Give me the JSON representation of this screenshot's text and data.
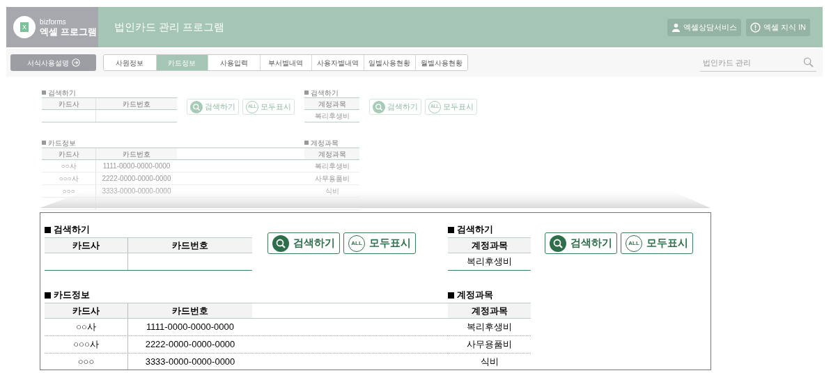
{
  "header": {
    "logo_icon_text": "X",
    "logo_top": "bizforms",
    "logo_main": "엑셀 프로그램",
    "title": "법인카드 관리 프로그램",
    "buttons": [
      {
        "kind": "consult",
        "label": "엑셀상담서비스"
      },
      {
        "kind": "info",
        "label": "엑셀 지식 IN"
      }
    ]
  },
  "nav": {
    "guide_button": "서식사용설명",
    "tabs": [
      {
        "label": "사원정보",
        "selected": false
      },
      {
        "label": "카드정보",
        "selected": true
      },
      {
        "label": "사용입력",
        "selected": false
      },
      {
        "label": "부서별내역",
        "selected": false
      },
      {
        "label": "사용자별내역",
        "selected": false
      },
      {
        "label": "일별사용현황",
        "selected": false
      },
      {
        "label": "월별사용현황",
        "selected": false
      }
    ],
    "search": {
      "placeholder": "법인카드 관리"
    }
  },
  "sheet": {
    "card_search": {
      "title": "검색하기",
      "columns": [
        "카드사",
        "카드번호"
      ]
    },
    "card_buttons": [
      {
        "kind": "search",
        "label": "검색하기"
      },
      {
        "kind": "all",
        "label": "모두표시",
        "icon_text": "ALL"
      }
    ],
    "account_search": {
      "title": "검색하기",
      "columns": [
        "계정과목"
      ],
      "value": "복리후생비"
    },
    "account_buttons": [
      {
        "kind": "search",
        "label": "검색하기"
      },
      {
        "kind": "all",
        "label": "모두표시",
        "icon_text": "ALL"
      }
    ],
    "card_info": {
      "title": "카드정보",
      "columns": [
        "카드사",
        "카드번호"
      ],
      "rows": [
        [
          "○○사",
          "1111-0000-0000-0000"
        ],
        [
          "○○○사",
          "2222-0000-0000-0000"
        ],
        [
          "○○○",
          "3333-0000-0000-0000"
        ]
      ]
    },
    "accounts": {
      "title": "계정과목",
      "columns": [
        "계정과목"
      ],
      "rows": [
        [
          "복리후생비"
        ],
        [
          "사무용품비"
        ],
        [
          "식비"
        ]
      ]
    }
  },
  "magnified_sheet": {
    "card_search": {
      "title": "검색하기",
      "columns": [
        "카드사",
        "카드번호"
      ]
    },
    "card_buttons": [
      {
        "kind": "search",
        "label": "검색하기"
      },
      {
        "kind": "all",
        "label": "모두표시",
        "icon_text": "ALL"
      }
    ],
    "account_search": {
      "title": "검색하기",
      "columns": [
        "계정과목"
      ],
      "value": "복리후생비"
    },
    "account_buttons": [
      {
        "kind": "search",
        "label": "검색하기"
      },
      {
        "kind": "all",
        "label": "모두표시",
        "icon_text": "ALL"
      }
    ],
    "card_info": {
      "title": "카드정보",
      "columns": [
        "카드사",
        "카드번호"
      ],
      "rows": [
        [
          "○○사",
          "1111-0000-0000-0000"
        ],
        [
          "○○○사",
          "2222-0000-0000-0000"
        ],
        [
          "○○○",
          "3333-0000-0000-0000"
        ]
      ]
    },
    "accounts": {
      "title": "계정과목",
      "columns": [
        "계정과목"
      ],
      "rows": [
        [
          "복리후생비"
        ],
        [
          "사무용품비"
        ],
        [
          "식비"
        ]
      ]
    }
  }
}
